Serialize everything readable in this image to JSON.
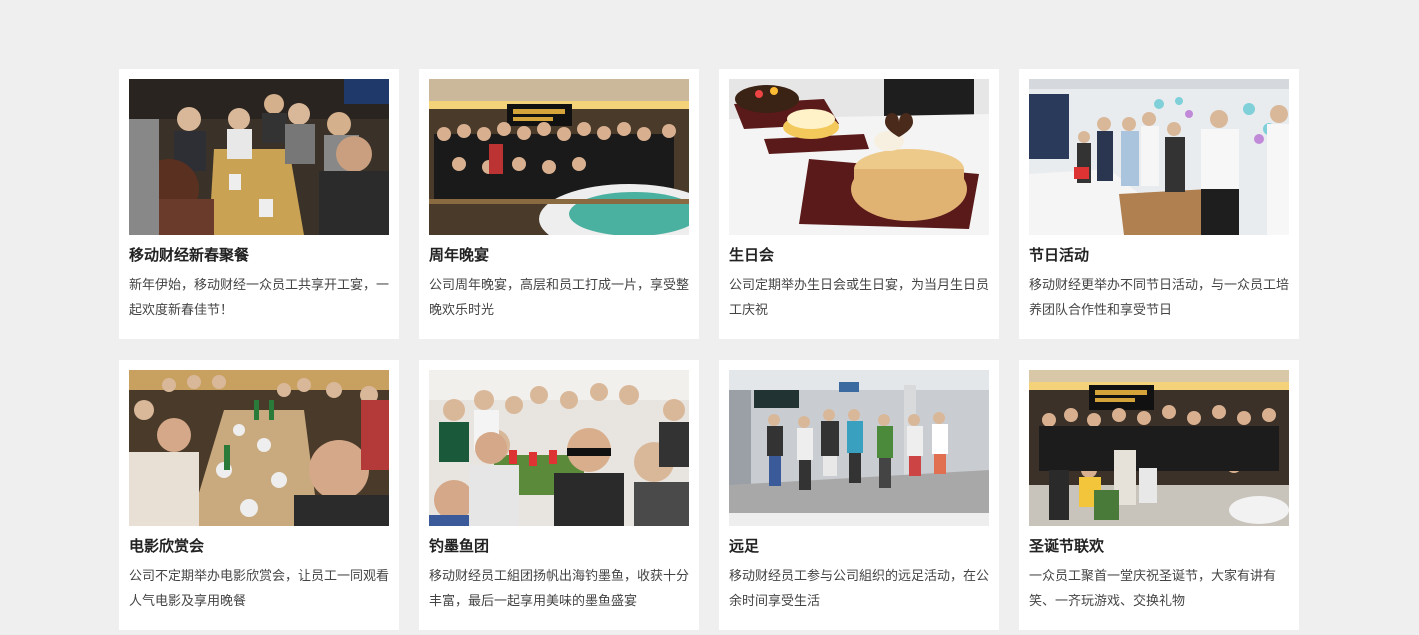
{
  "cards": [
    {
      "title": "移动财经新春聚餐",
      "desc": "新年伊始，移动财经一众员工共享开工宴，一起欢度新春佳节！"
    },
    {
      "title": "周年晚宴",
      "desc": "公司周年晚宴，高层和员工打成一片，享受整晚欢乐时光"
    },
    {
      "title": "生日会",
      "desc": "公司定期举办生日会或生日宴，为当月生日员工庆祝"
    },
    {
      "title": "节日活动",
      "desc": "移动财经更举办不同节日活动，与一众员工培养团队合作性和享受节日"
    },
    {
      "title": "电影欣赏会",
      "desc": "公司不定期举办电影欣赏会，让员工一同观看人气电影及享用晚餐"
    },
    {
      "title": "钓墨鱼团",
      "desc": "移动财经员工組团扬帆出海钓墨鱼，收获十分丰富，最后一起享用美味的墨鱼盛宴"
    },
    {
      "title": "远足",
      "desc": "移动财经员工参与公司組织的远足活动，在公余时间享受生活"
    },
    {
      "title": "圣诞节联欢",
      "desc": "一众员工聚首一堂庆祝圣诞节，大家有讲有笑、一齐玩游戏、交换礼物"
    }
  ]
}
